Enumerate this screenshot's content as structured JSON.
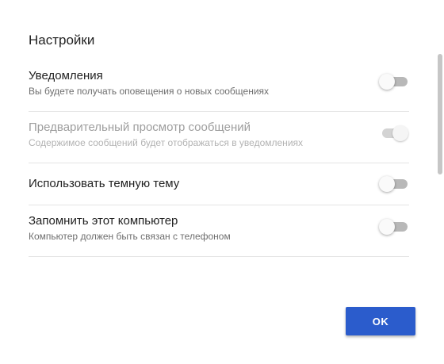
{
  "dialog": {
    "title": "Настройки",
    "ok_label": "OK"
  },
  "settings": [
    {
      "label": "Уведомления",
      "description": "Вы будете получать оповещения о новых сообщениях",
      "state": "off",
      "disabled": false
    },
    {
      "label": "Предварительный просмотр сообщений",
      "description": "Содержимое сообщений будет отображаться в уведомлениях",
      "state": "on",
      "disabled": true
    },
    {
      "label": "Использовать темную тему",
      "state": "off",
      "disabled": false
    },
    {
      "label": "Запомнить этот компьютер",
      "description": "Компьютер должен быть связан с телефоном",
      "state": "off",
      "disabled": false
    }
  ],
  "colors": {
    "accent": "#2b5ccc",
    "track_off": "#b8b8b8",
    "divider": "#e4e4e4"
  }
}
